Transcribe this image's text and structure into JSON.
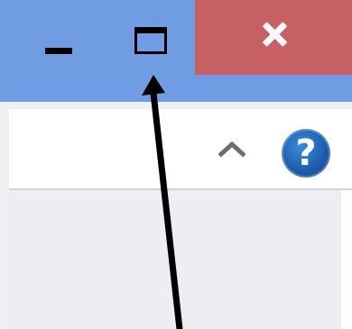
{
  "window": {
    "title_bar_color": "#6f9ce3",
    "close_color": "#c66064"
  },
  "controls": {
    "minimize_icon": "minimize-icon",
    "maximize_icon": "maximize-icon",
    "close_icon": "close-icon",
    "collapse_icon": "chevron-up-icon",
    "help_icon": "help-icon",
    "help_glyph": "?"
  },
  "annotation": {
    "type": "arrow",
    "points_to": "maximize-button",
    "color": "#000000"
  }
}
